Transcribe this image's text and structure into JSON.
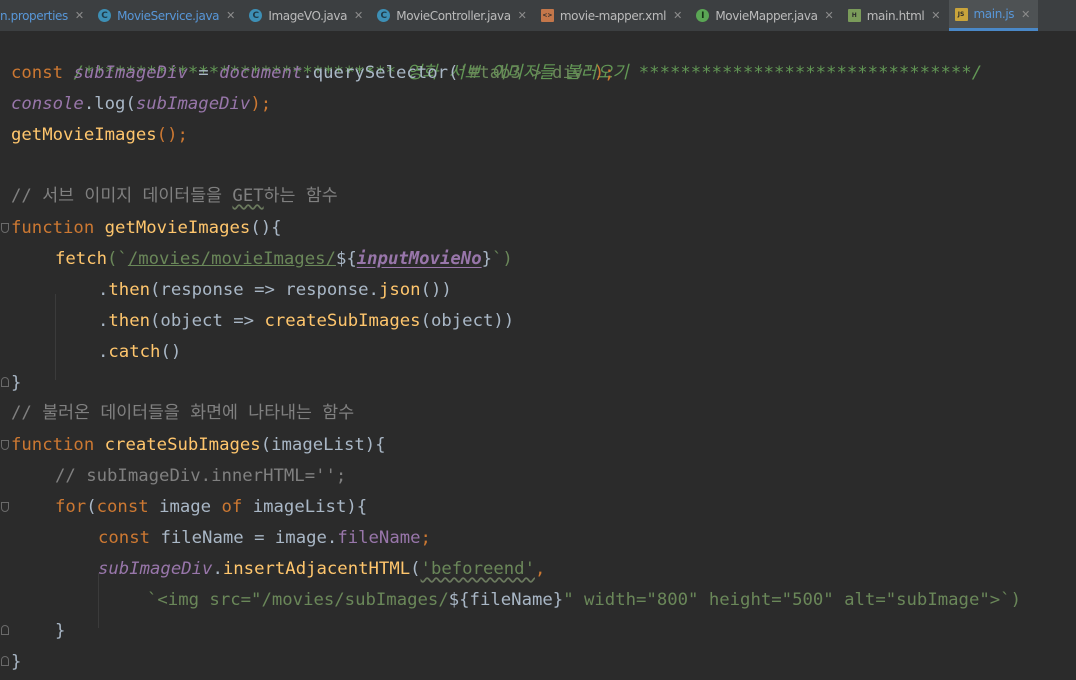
{
  "tabs": [
    {
      "label": "n.properties",
      "icon": "properties",
      "active": false,
      "modified": true
    },
    {
      "label": "MovieService.java",
      "icon": "class-icon",
      "active": false,
      "modified": true
    },
    {
      "label": "ImageVO.java",
      "icon": "class-icon",
      "active": false
    },
    {
      "label": "MovieController.java",
      "icon": "class-icon",
      "active": false
    },
    {
      "label": "movie-mapper.xml",
      "icon": "xml-file-icon",
      "active": false
    },
    {
      "label": "MovieMapper.java",
      "icon": "interface-icon",
      "active": false
    },
    {
      "label": "main.html",
      "icon": "html-file-icon",
      "active": false
    },
    {
      "label": "main.js",
      "icon": "js-file-icon",
      "active": true
    }
  ],
  "code": {
    "l1_comment": "/****************************** 영화 서브 이미지들 불러오기 ********************************/",
    "l2_const": "const ",
    "l2_var": "subImageDiv",
    "l2_eq": " = ",
    "l2_doc": "document",
    "l2_dot": ".querySelector(",
    "l2_str": "'#tab3 > div'",
    "l2_end": ");",
    "l3_console": "console",
    "l3_log": ".log(",
    "l3_var": "subImageDiv",
    "l3_end": ");",
    "l4_call": "getMovieImages",
    "l4_end": "();",
    "l6_comment_a": "// 서브 이미지 데이터들을 ",
    "l6_comment_b": "GET",
    "l6_comment_c": "하는 함수",
    "l7_kw": "function ",
    "l7_fn": "getMovieImages",
    "l7_end": "(){",
    "l8_fetch": "fetch",
    "l8_open": "(`",
    "l8_url": "/movies/movieImages/",
    "l8_tpl_open": "${",
    "l8_var": "inputMovieNo",
    "l8_tpl_close": "}",
    "l8_close": "`)",
    "l9_dot": ".",
    "l9_then": "then",
    "l9_mid": "(response => response.",
    "l9_json": "json",
    "l9_end": "())",
    "l10_dot": ".",
    "l10_then": "then",
    "l10_mid": "(object => ",
    "l10_fn": "createSubImages",
    "l10_end": "(object))",
    "l11_dot": ".",
    "l11_catch": "catch",
    "l11_end": "()",
    "l12": "}",
    "l13_comment": "// 불러온 데이터들을 화면에 나타내는 함수",
    "l14_kw": "function ",
    "l14_fn": "createSubImages",
    "l14_end": "(imageList){",
    "l15_comment": "// subImageDiv.innerHTML='';",
    "l16_for": "for",
    "l16_open": "(",
    "l16_const": "const ",
    "l16_mid": "image ",
    "l16_of": "of ",
    "l16_end": "imageList){",
    "l17_const": "const ",
    "l17_mid": "fileName = image.",
    "l17_prop": "fileName",
    "l17_end": ";",
    "l18_var": "subImageDiv",
    "l18_dot": ".",
    "l18_fn": "insertAdjacentHTML",
    "l18_open": "(",
    "l18_str": "'beforeend'",
    "l18_comma": ",",
    "l19_a": "`<img src=\"/movies/subImages/",
    "l19_b": "${fileName}",
    "l19_c": "\" width=\"800\" height=\"500\" alt=\"subImage\">`)",
    "l20": "}",
    "l21": "}"
  },
  "colors": {
    "background": "#2b2b2b",
    "keyword": "#cc7832",
    "function": "#ffc66d",
    "string": "#6a8759",
    "comment": "#808080",
    "doc_comment": "#629755",
    "variable": "#9876aa",
    "active_tab_underline": "#4a88c7"
  }
}
